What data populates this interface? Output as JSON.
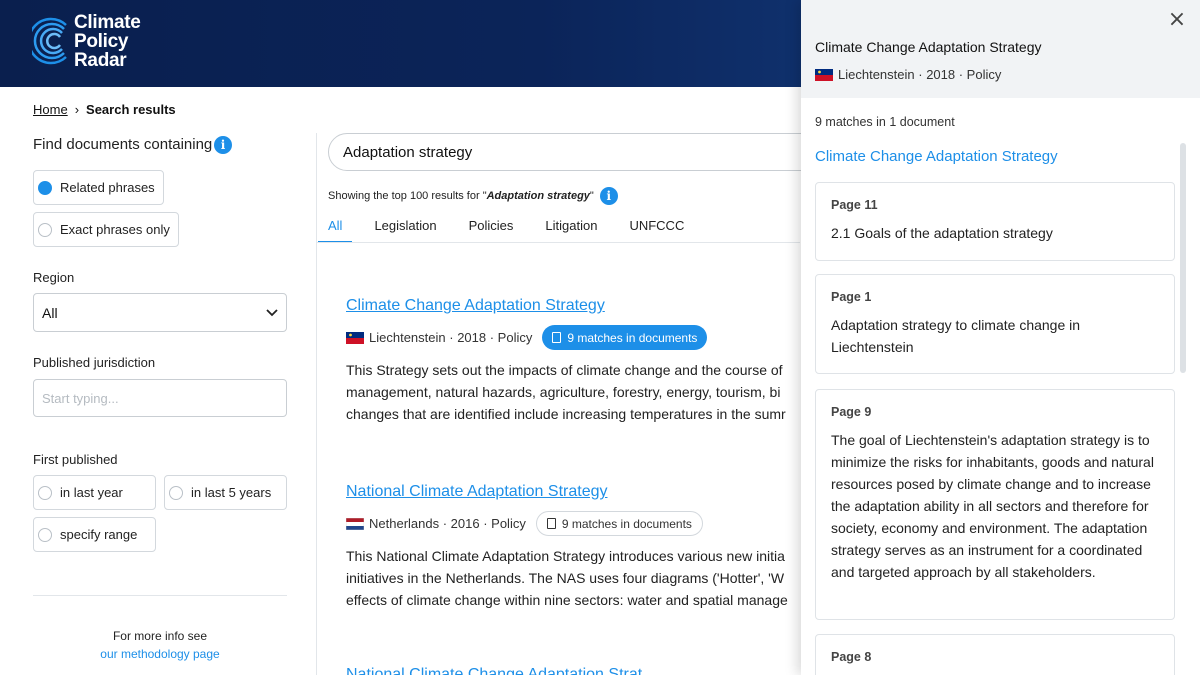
{
  "header": {
    "logo_line1": "Climate",
    "logo_line2": "Policy",
    "logo_line3": "Radar"
  },
  "breadcrumb": {
    "home": "Home",
    "separator": "›",
    "current": "Search results"
  },
  "sidebar": {
    "find_label": "Find documents containing",
    "info": "i",
    "related": "Related phrases",
    "exact": "Exact phrases only",
    "region_label": "Region",
    "region_value": "All",
    "jurisdiction_label": "Published jurisdiction",
    "jurisdiction_placeholder": "Start typing...",
    "first_published_label": "First published",
    "last_year": "in last year",
    "last_5": "in last 5 years",
    "range": "specify range",
    "more_info": "For more info see",
    "methodology": "our methodology page"
  },
  "search": {
    "query": "Adaptation strategy",
    "showing_prefix": "Showing the top 100 results for \"",
    "showing_query": "Adaptation strategy",
    "showing_suffix": "\""
  },
  "tabs": [
    "All",
    "Legislation",
    "Policies",
    "Litigation",
    "UNFCCC"
  ],
  "results": [
    {
      "title": "Climate Change Adaptation Strategy",
      "country": "Liechtenstein",
      "year": "2018",
      "type": "Policy",
      "matches": "9 matches in documents",
      "desc": [
        "This Strategy sets out the impacts of climate change and the course of",
        "management,  natural hazards, agriculture, forestry, energy, tourism, bi",
        "changes that are identified include increasing temperatures in the sumr"
      ]
    },
    {
      "title": "National Climate Adaptation Strategy",
      "country": "Netherlands",
      "year": "2016",
      "type": "Policy",
      "matches": "9 matches in documents",
      "desc": [
        "This National Climate Adaptation Strategy introduces various new initia",
        "initiatives in the Netherlands.  The NAS uses four diagrams ('Hotter', 'W",
        "effects of climate change within nine sectors: water and spatial manage"
      ]
    },
    {
      "title": "National Climate Change Adaptation Strat"
    }
  ],
  "panel": {
    "title": "Climate Change Adaptation Strategy",
    "country": "Liechtenstein",
    "year": "2018",
    "type": "Policy",
    "close": "×",
    "matches_count": "9 matches in 1 document",
    "doc_link": "Climate Change Adaptation Strategy",
    "cards": [
      {
        "page": "Page 11",
        "text": "2.1 Goals of the adaptation strategy"
      },
      {
        "page": "Page 1",
        "text": "Adaptation strategy to climate change in Liechtenstein"
      },
      {
        "page": "Page 9",
        "text": "The goal of Liechtenstein's adaptation strategy is to minimize the risks for inhabitants, goods and natural resources posed by climate change and to increase the adaptation ability in all sectors and therefore for society, economy and environment. The adaptation strategy serves as an instrument for a coordinated and targeted approach by all stakeholders."
      },
      {
        "page": "Page 8",
        "text": ""
      }
    ]
  },
  "colors": {
    "accent": "#1d8fe8",
    "header_dark": "#0a1f4e"
  }
}
